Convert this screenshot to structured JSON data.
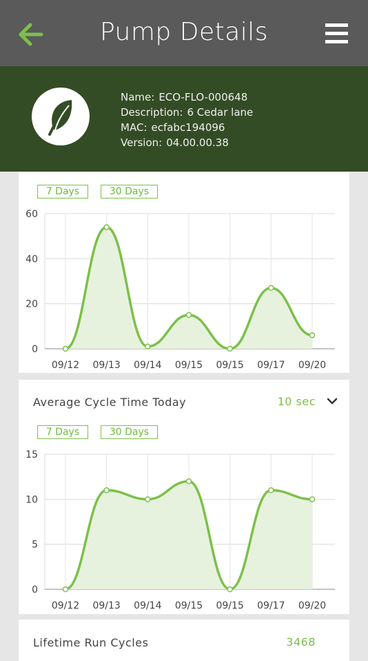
{
  "header": {
    "title": "Pump Details",
    "back_icon": "back-arrow-icon",
    "menu_icon": "hamburger-menu-icon"
  },
  "device": {
    "avatar_icon": "leaf-icon",
    "name_label": "Name:",
    "name": "ECO-FLO-000648",
    "description_label": "Description:",
    "description": "6 Cedar lane",
    "mac_label": "MAC:",
    "mac": "ecfabc194096",
    "version_label": "Version:",
    "version": "04.00.00.38"
  },
  "colors": {
    "header_bg": "#5a5a5a",
    "band_bg": "#344c25",
    "accent": "#7cc04a",
    "area_fill": "#e7f2de"
  },
  "card1": {
    "range_7": "7 Days",
    "range_30": "30 Days"
  },
  "card2": {
    "label": "Average Cycle Time Today",
    "value": "10 sec",
    "expand_icon": "chevron-down-icon",
    "range_7": "7 Days",
    "range_30": "30 Days"
  },
  "card3": {
    "label": "Lifetime Run Cycles",
    "value": "3468"
  },
  "chart_data": [
    {
      "type": "area",
      "x": [
        "09/12",
        "09/13",
        "09/14",
        "09/15",
        "09/15",
        "09/17",
        "09/20"
      ],
      "values": [
        0,
        54,
        1,
        15,
        0,
        27,
        6
      ],
      "ylim": [
        0,
        60
      ],
      "yticks": [
        0,
        20,
        40,
        60
      ],
      "grid": true
    },
    {
      "type": "area",
      "x": [
        "09/12",
        "09/13",
        "09/14",
        "09/15",
        "09/15",
        "09/17",
        "09/20"
      ],
      "values": [
        0,
        11,
        10,
        12,
        0,
        11,
        10
      ],
      "ylim": [
        0,
        15
      ],
      "yticks": [
        0,
        5,
        10,
        15
      ],
      "grid": true
    }
  ]
}
